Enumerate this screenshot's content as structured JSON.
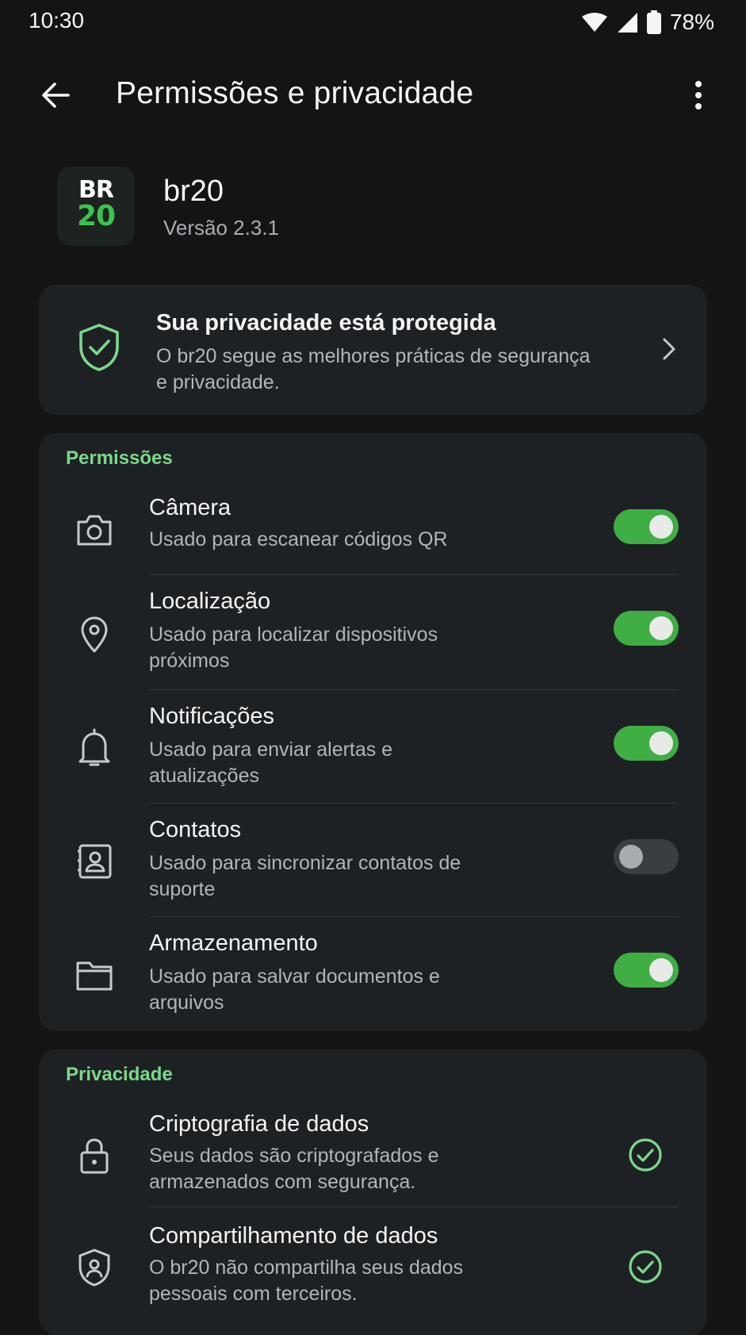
{
  "status_bar": {
    "time": "10:30",
    "battery": "78%"
  },
  "app_bar": {
    "title": "Permissões e privacidade",
    "back_icon": "arrow-left-icon",
    "menu_icon": "more-vertical-icon"
  },
  "app": {
    "logo_line1": "BR",
    "logo_line2": "20",
    "name": "br20",
    "version": "Versão 2.3.1"
  },
  "privacy_banner": {
    "title": "Sua privacidade está protegida",
    "description": "O br20 segue as melhores práticas de segurança e privacidade.",
    "icon": "shield-check-icon"
  },
  "permissions": {
    "section_title": "Permissões",
    "items": [
      {
        "title": "Câmera",
        "description": "Usado para escanear códigos QR",
        "enabled": true,
        "icon": "camera-icon"
      },
      {
        "title": "Localização",
        "description": "Usado para localizar dispositivos próximos",
        "enabled": true,
        "icon": "location-pin-icon"
      },
      {
        "title": "Notificações",
        "description": "Usado para enviar alertas e atualizações",
        "enabled": true,
        "icon": "bell-icon"
      },
      {
        "title": "Contatos",
        "description": "Usado para sincronizar contatos de suporte",
        "enabled": false,
        "icon": "contact-book-icon"
      },
      {
        "title": "Armazenamento",
        "description": "Usado para salvar documentos e arquivos",
        "enabled": true,
        "icon": "folder-icon"
      }
    ]
  },
  "privacy": {
    "section_title": "Privacidade",
    "items": [
      {
        "title": "Criptografia de dados",
        "description": "Seus dados são criptografados e armazenados com segurança.",
        "icon": "lock-icon",
        "status_icon": "check-circle-icon"
      },
      {
        "title": "Compartilhamento de dados",
        "description": "O br20 não compartilha seus dados pessoais com terceiros.",
        "icon": "user-shield-icon",
        "status_icon": "check-circle-icon"
      }
    ]
  },
  "colors": {
    "background": "#121416",
    "card": "#1e2124",
    "accent": "#3fae44",
    "section_title": "#7bd88b"
  }
}
